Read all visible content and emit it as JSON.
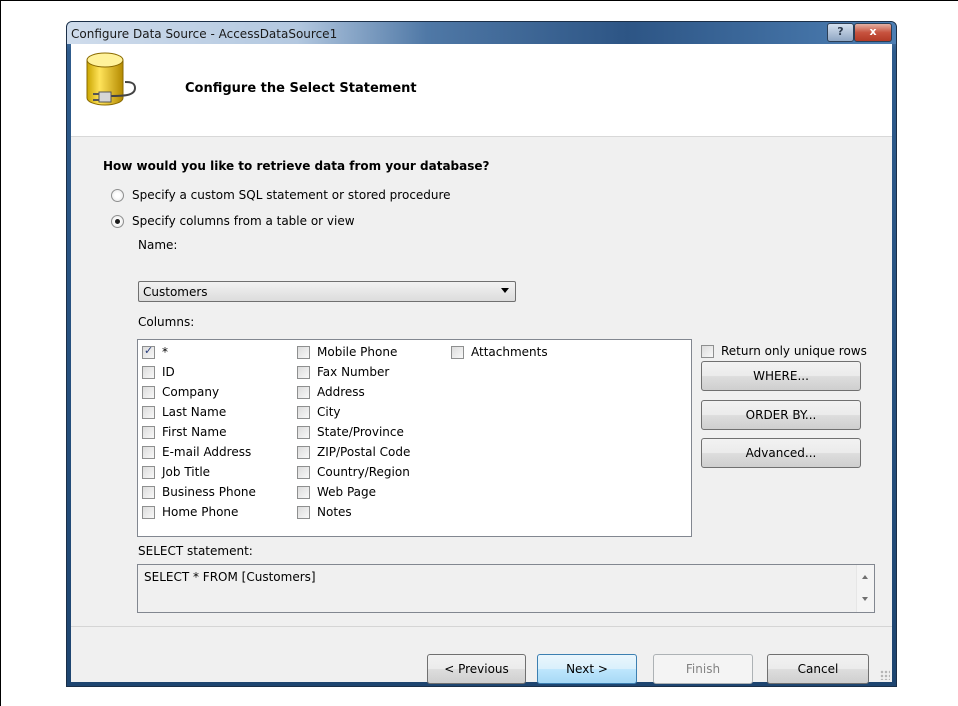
{
  "window": {
    "title": "Configure Data Source - AccessDataSource1",
    "help_label": "?",
    "close_label": "x"
  },
  "header": {
    "title": "Configure the Select Statement",
    "icon": "database-connection-icon"
  },
  "question": "How would you like to retrieve data from your database?",
  "options": [
    {
      "label": "Specify a custom SQL statement or stored procedure",
      "selected": false
    },
    {
      "label": "Specify columns from a table or view",
      "selected": true
    }
  ],
  "name": {
    "label": "Name:",
    "selected": "Customers"
  },
  "columns": {
    "label": "Columns:",
    "col1": [
      {
        "label": "*",
        "checked": true
      },
      {
        "label": "ID",
        "checked": false
      },
      {
        "label": "Company",
        "checked": false
      },
      {
        "label": "Last Name",
        "checked": false
      },
      {
        "label": "First Name",
        "checked": false
      },
      {
        "label": "E-mail Address",
        "checked": false
      },
      {
        "label": "Job Title",
        "checked": false
      },
      {
        "label": "Business Phone",
        "checked": false
      },
      {
        "label": "Home Phone",
        "checked": false
      }
    ],
    "col2": [
      {
        "label": "Mobile Phone",
        "checked": false
      },
      {
        "label": "Fax Number",
        "checked": false
      },
      {
        "label": "Address",
        "checked": false
      },
      {
        "label": "City",
        "checked": false
      },
      {
        "label": "State/Province",
        "checked": false
      },
      {
        "label": "ZIP/Postal Code",
        "checked": false
      },
      {
        "label": "Country/Region",
        "checked": false
      },
      {
        "label": "Web Page",
        "checked": false
      },
      {
        "label": "Notes",
        "checked": false
      }
    ],
    "col3": [
      {
        "label": "Attachments",
        "checked": false
      }
    ]
  },
  "side": {
    "unique_rows_label": "Return only unique rows",
    "where_label": "WHERE...",
    "orderby_label": "ORDER BY...",
    "advanced_label": "Advanced..."
  },
  "statement": {
    "label": "SELECT statement:",
    "text": "SELECT * FROM [Customers]"
  },
  "footer": {
    "previous_label": "< Previous",
    "next_label": "Next >",
    "finish_label": "Finish",
    "cancel_label": "Cancel"
  }
}
